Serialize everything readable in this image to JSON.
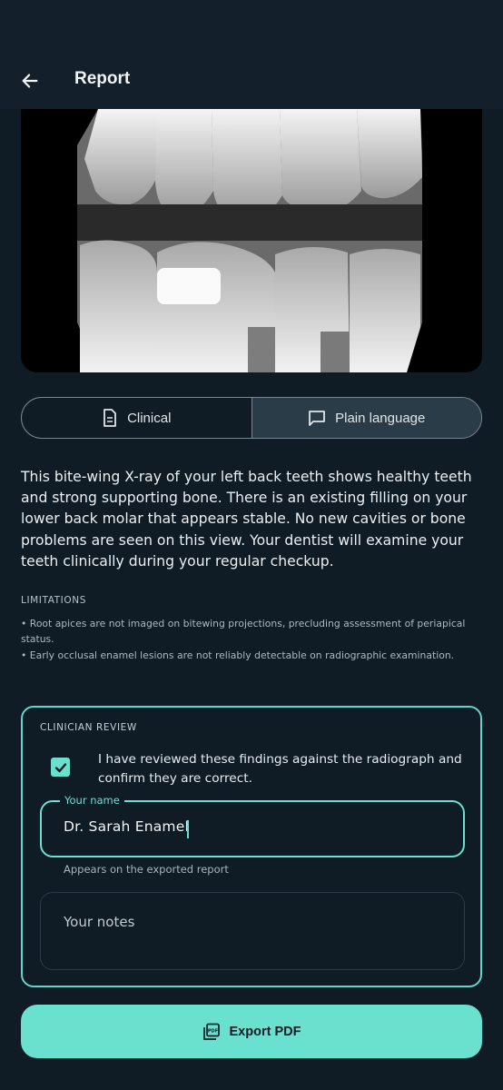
{
  "header": {
    "title": "Report",
    "back_icon": "arrow-left-icon"
  },
  "radiograph": {
    "alt": "Bite-wing X-ray"
  },
  "view_toggle": {
    "options": [
      {
        "label": "Clinical",
        "icon": "document-icon",
        "selected": false
      },
      {
        "label": "Plain language",
        "icon": "chat-bubble-icon",
        "selected": true
      }
    ]
  },
  "summary": "This bite-wing X-ray of your left back teeth shows healthy teeth and strong supporting bone. There is an existing filling on your lower back molar that appears stable. No new cavities or bone problems are seen on this view. Your dentist will examine your teeth clinically during your regular checkup.",
  "limitations": {
    "title": "LIMITATIONS",
    "items": [
      "• Root apices are not imaged on bitewing projections, precluding assessment of periapical status.",
      "• Early occlusal enamel lesions are not reliably detectable on radiographic examination."
    ]
  },
  "clinician_review": {
    "title": "CLINICIAN REVIEW",
    "confirm_checked": true,
    "confirm_label": "I have reviewed these findings against the radiograph and confirm they are correct.",
    "name_label": "Your name",
    "name_value": "Dr. Sarah Enamel",
    "name_helper": "Appears on the exported report",
    "notes_placeholder": "Your notes",
    "notes_value": ""
  },
  "export": {
    "label": "Export PDF",
    "icon": "pdf-icon"
  },
  "colors": {
    "accent": "#6ae0cf",
    "background": "#0f1b25",
    "appbar": "#13202c"
  }
}
